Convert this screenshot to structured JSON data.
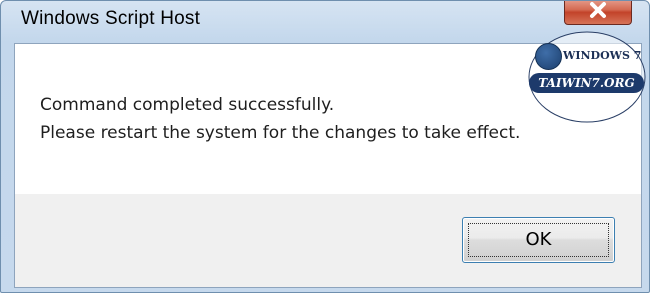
{
  "window": {
    "title": "Windows Script Host"
  },
  "message": {
    "line1": "Command completed successfully.",
    "line2": "Please restart the system for the changes to take effect."
  },
  "buttons": {
    "ok_label": "OK",
    "close_icon": "close-icon"
  },
  "watermark": {
    "top_text": "WINDOWS 7",
    "bottom_text": "TAIWIN7.ORG"
  },
  "colors": {
    "close_button": "#c2432a",
    "ok_focus_border": "#3c7fb1",
    "watermark_navy": "#1d3a6b"
  }
}
